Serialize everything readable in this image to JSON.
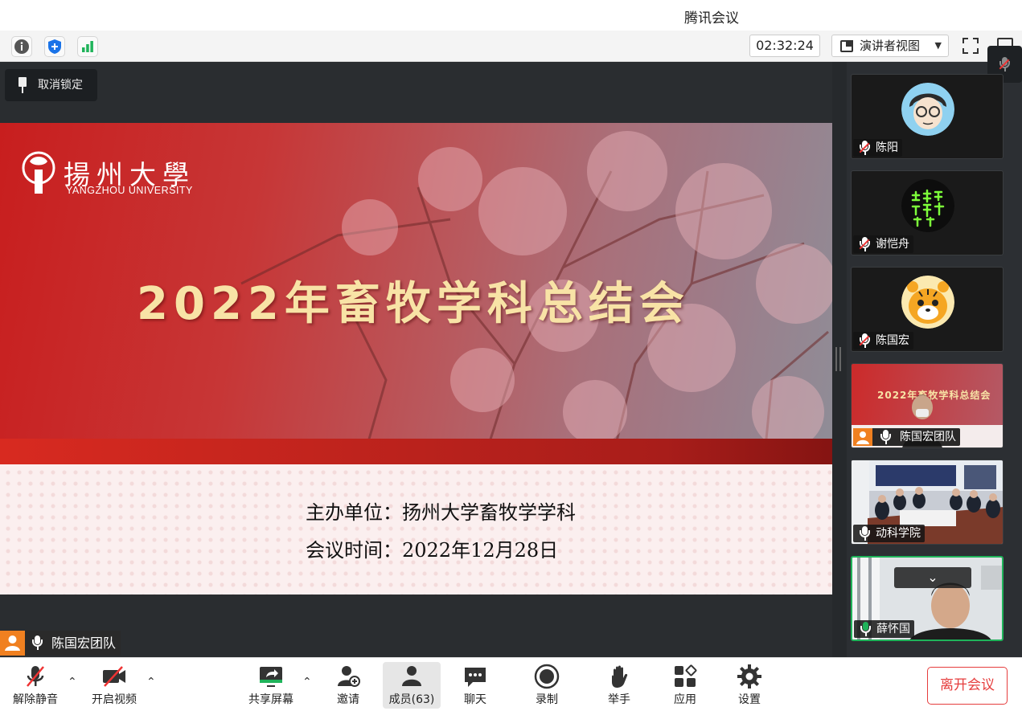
{
  "app_title": "腾讯会议",
  "topbar": {
    "timer": "02:32:24",
    "view_mode": "演讲者视图",
    "icons": [
      "info-icon",
      "shield-icon",
      "signal-icon",
      "fullscreen-icon",
      "window-icon"
    ]
  },
  "main": {
    "unlock_label": "取消锁定",
    "slide": {
      "logo_cn": "揚州大學",
      "logo_en": "YANGZHOU UNIVERSITY",
      "title": "2022年畜牧学科总结会",
      "organizer": "主办单位：扬州大学畜牧学学科",
      "date": "会议时间：2022年12月28日"
    },
    "speaker_tag": "陈国宏团队"
  },
  "participants": [
    {
      "name": "陈阳",
      "muted": true
    },
    {
      "name": "谢恺舟",
      "muted": true
    },
    {
      "name": "陈国宏",
      "muted": true
    },
    {
      "name": "陈国宏团队",
      "muted": false
    },
    {
      "name": "动科学院",
      "muted": false
    },
    {
      "name": "薛怀国",
      "muted": false
    }
  ],
  "toolbar": {
    "unmute": "解除静音",
    "start_video": "开启视频",
    "share_screen": "共享屏幕",
    "invite": "邀请",
    "members": "成员(63)",
    "chat": "聊天",
    "record": "录制",
    "raise_hand": "举手",
    "apps": "应用",
    "settings": "设置",
    "leave": "离开会议"
  },
  "colors": {
    "accent_green": "#1fb35a",
    "accent_blue": "#1a73e8",
    "leave_red": "#e63d3d",
    "slide_red": "#c81e1e",
    "title_gold": "#f8e3a6"
  }
}
